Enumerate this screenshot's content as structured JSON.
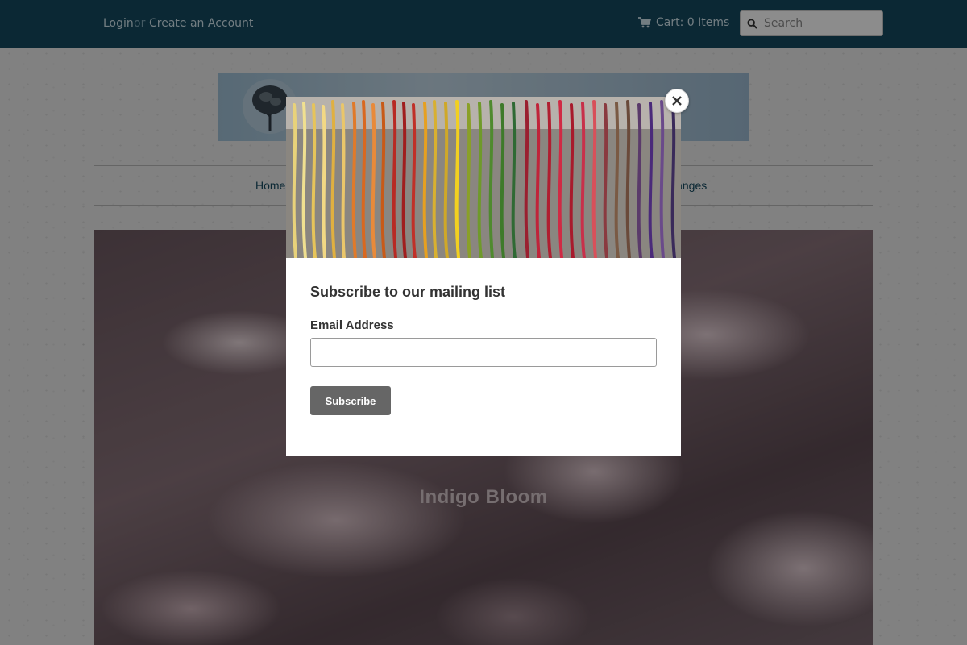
{
  "header": {
    "login_label": "Login",
    "or_label": "or",
    "create_account_label": "Create an Account",
    "cart_label": "Cart: 0 Items",
    "search_placeholder": "Search"
  },
  "nav": {
    "items": [
      {
        "label": "Home"
      },
      {
        "label": "Ranges"
      }
    ]
  },
  "hero": {
    "title": "Indigo Bloom"
  },
  "modal": {
    "heading": "Subscribe to our mailing list",
    "email_label": "Email Address",
    "email_value": "",
    "subscribe_label": "Subscribe"
  },
  "icons": {
    "cart": "cart-icon",
    "search": "search-icon",
    "close": "close-icon",
    "logo": "tree-logo-icon"
  },
  "colors": {
    "topbar": "#14495f",
    "link": "#14495f",
    "button": "#666666"
  }
}
